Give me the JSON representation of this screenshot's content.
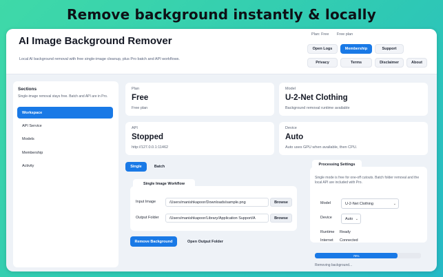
{
  "banner": "Remove background instantly & locally",
  "header": {
    "title": "AI Image Background Remover",
    "subtitle": "Local AI background removal with free single-image cleanup, plus Pro batch and API workflows.",
    "plan_label": "Plan: Free",
    "plan_value": "Free plan",
    "buttons": [
      "Open Logs",
      "Membership",
      "Support",
      "Privacy",
      "Terms",
      "Disclaimer",
      "About"
    ]
  },
  "sidebar": {
    "title": "Sections",
    "description": "Single-image removal stays free. Batch and API are in Pro.",
    "items": [
      "Workspace",
      "API Service",
      "Models",
      "Membership",
      "Activity"
    ]
  },
  "cards": {
    "plan": {
      "label": "Plan",
      "value": "Free",
      "sub": "Free plan"
    },
    "model": {
      "label": "Model",
      "value": "U-2-Net Clothing",
      "sub": "Background removal runtime available"
    },
    "api": {
      "label": "API",
      "value": "Stopped",
      "sub": "http://127.0.0.1:11462"
    },
    "device": {
      "label": "Device",
      "value": "Auto",
      "sub": "Auto uses GPU when available, then CPU."
    }
  },
  "modes": {
    "single": "Single",
    "batch": "Batch"
  },
  "workflow": {
    "title": "Single Image Workflow",
    "input_label": "Input Image",
    "input_value": "/Users/manishkapoor/Downloads/sample.png",
    "output_label": "Output Folder",
    "output_value": "/Users/manishkapoor/Library/Application Support/A",
    "browse": "Browse",
    "remove_btn": "Remove Background",
    "open_output_btn": "Open Output Folder"
  },
  "processing": {
    "title": "Processing Settings",
    "description": "Single mode is free for one-off cutouts. Batch folder removal and the local API are included with Pro.",
    "model_label": "Model",
    "model_value": "U-2-Net Clothing",
    "device_label": "Device",
    "device_value": "Auto",
    "runtime_label": "Runtime",
    "runtime_value": "Ready",
    "internet_label": "Internet",
    "internet_value": "Connected",
    "progress_percent": 78,
    "progress_text": "78%",
    "status": "Removing background..."
  },
  "colors": {
    "accent": "#1979e6",
    "background_gradient_start": "#3fd9a8",
    "background_gradient_end": "#26b9c6"
  }
}
